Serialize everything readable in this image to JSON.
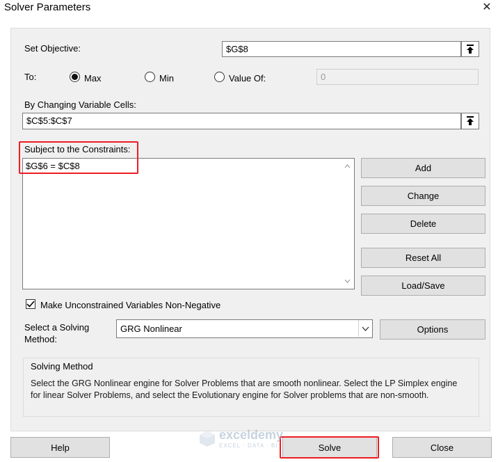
{
  "window": {
    "title": "Solver Parameters",
    "close_glyph": "✕"
  },
  "objective": {
    "label": "Set Objective:",
    "value": "$G$8"
  },
  "to": {
    "label": "To:",
    "options": [
      {
        "label": "Max",
        "selected": true
      },
      {
        "label": "Min",
        "selected": false
      },
      {
        "label": "Value Of:",
        "selected": false
      }
    ],
    "value_of": "0"
  },
  "changing_cells": {
    "label": "By Changing Variable Cells:",
    "value": "$C$5:$C$7"
  },
  "constraints": {
    "label": "Subject to the Constraints:",
    "items": [
      "$G$6 = $C$8"
    ]
  },
  "constraint_buttons": {
    "add": "Add",
    "change": "Change",
    "delete": "Delete",
    "reset_all": "Reset All",
    "load_save": "Load/Save"
  },
  "non_negative": {
    "label": "Make Unconstrained Variables Non-Negative",
    "checked": true
  },
  "solving_method": {
    "label_line1": "Select a Solving",
    "label_line2": "Method:",
    "selected": "GRG Nonlinear",
    "options_button": "Options"
  },
  "method_info": {
    "heading": "Solving Method",
    "description": "Select the GRG Nonlinear engine for Solver Problems that are smooth nonlinear. Select the LP Simplex engine for linear Solver Problems, and select the Evolutionary engine for Solver problems that are non-smooth."
  },
  "footer": {
    "help": "Help",
    "solve": "Solve",
    "close": "Close"
  },
  "watermark": {
    "name": "exceldemy",
    "tagline": "EXCEL · DATA · BI"
  },
  "colors": {
    "highlight": "#ee1c24",
    "panel": "#f0f0f0",
    "button": "#e1e1e1"
  }
}
